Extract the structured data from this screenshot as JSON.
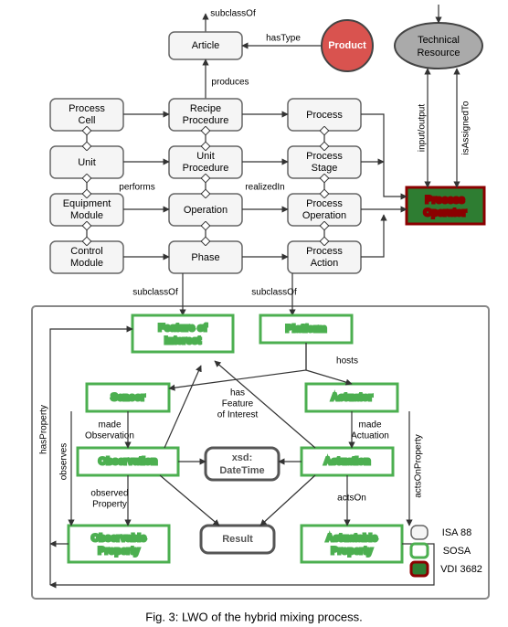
{
  "top": {
    "subclassOf": "subclassOf",
    "article": "Article",
    "hasType": "hasType",
    "product": "Product",
    "technical": [
      "Technical",
      "Resource"
    ],
    "produces": "produces",
    "processCell": [
      "Process",
      "Cell"
    ],
    "recipeProcedure": [
      "Recipe",
      "Procedure"
    ],
    "process": "Process",
    "unit": "Unit",
    "unitProcedure": [
      "Unit",
      "Procedure"
    ],
    "processStage": [
      "Process",
      "Stage"
    ],
    "performs": "performs",
    "realizedIn": "realizedIn",
    "equipmentModule": [
      "Equipment",
      "Module"
    ],
    "operation": "Operation",
    "processOperation": [
      "Process",
      "Operation"
    ],
    "controlModule": [
      "Control",
      "Module"
    ],
    "phase": "Phase",
    "processAction": [
      "Process",
      "Action"
    ],
    "inputOutput": "input/output",
    "isAssignedTo": "isAssignedTo",
    "processOperator": [
      "Process",
      "Operator"
    ]
  },
  "bottom": {
    "subclassOf1": "subclassOf",
    "subclassOf2": "subclassOf",
    "featureOfInterest": [
      "Feature of",
      "Interest"
    ],
    "platform": "Platform",
    "hosts": "hosts",
    "sensor": "Sensor",
    "hasFeatureOfInterest": [
      "has",
      "Feature",
      "of Interest"
    ],
    "actuator": "Actuator",
    "madeObservation": [
      "made",
      "Observation"
    ],
    "madeActuation": [
      "made",
      "Actuation"
    ],
    "observation": "Observation",
    "xsdDateTime": [
      "xsd:",
      "DateTime"
    ],
    "actuation": "Actuation",
    "observes": "observes",
    "observedProperty": [
      "observed",
      "Property"
    ],
    "actsOn": "actsOn",
    "actsOnProperty": "actsOnProperty",
    "hasProperty": "hasProperty",
    "observableProperty": [
      "Observable",
      "Property"
    ],
    "result": "Result",
    "actuatableProperty": [
      "Actuatable",
      "Property"
    ]
  },
  "legend": {
    "isa88": "ISA 88",
    "sosa": "SOSA",
    "vdi": "VDI 3682"
  },
  "caption": "Fig. 3: LWO of the hybrid mixing process."
}
